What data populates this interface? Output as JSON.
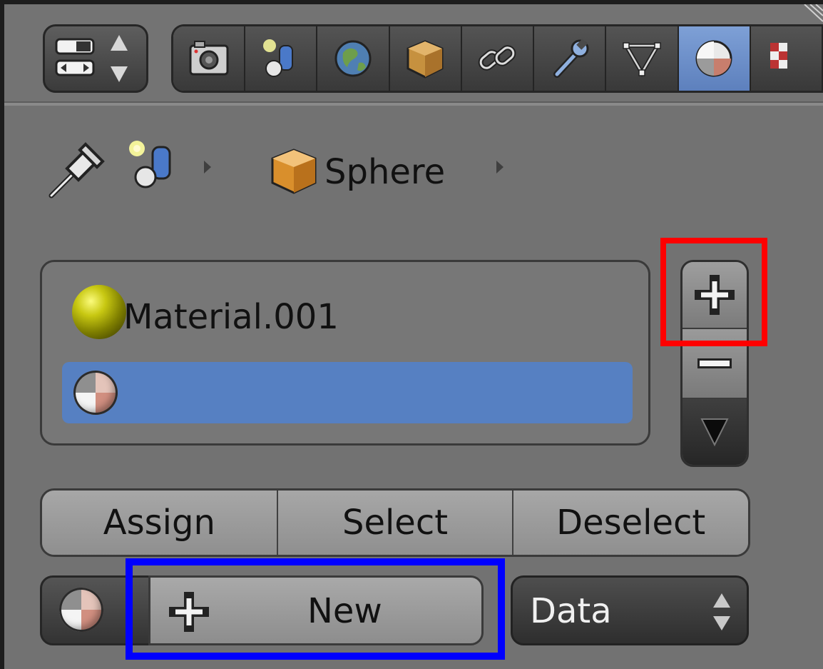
{
  "header": {
    "tabs": [
      {
        "name": "render",
        "icon": "camera-icon",
        "active": false
      },
      {
        "name": "render-layers",
        "icon": "render-layers-icon",
        "active": false
      },
      {
        "name": "scene",
        "icon": "scene-icon",
        "active": false
      },
      {
        "name": "world",
        "icon": "world-icon",
        "active": false
      },
      {
        "name": "object",
        "icon": "object-cube-icon",
        "active": false
      },
      {
        "name": "constraints",
        "icon": "constraint-link-icon",
        "active": false
      },
      {
        "name": "modifiers",
        "icon": "wrench-icon",
        "active": false
      },
      {
        "name": "data",
        "icon": "mesh-data-icon",
        "active": false
      },
      {
        "name": "material",
        "icon": "material-sphere-icon",
        "active": true
      },
      {
        "name": "texture",
        "icon": "texture-checker-icon",
        "active": false
      }
    ]
  },
  "breadcrumb": {
    "object_name": "Sphere"
  },
  "material_slots": {
    "items": [
      {
        "label": "Material.001",
        "icon": "yellow-material-icon",
        "selected": false
      },
      {
        "label": "",
        "icon": "material-sphere-icon",
        "selected": true
      }
    ],
    "side_buttons": [
      "add-slot",
      "remove-slot",
      "slot-specials"
    ]
  },
  "actions": {
    "assign": "Assign",
    "select": "Select",
    "deselect": "Deselect"
  },
  "datablock": {
    "new_label": "New",
    "link_label": "Data"
  },
  "colors": {
    "highlight_red": "#ff0000",
    "highlight_blue": "#0000ff",
    "selected_row": "#5680c2",
    "active_tab": "#6a8ccb"
  }
}
